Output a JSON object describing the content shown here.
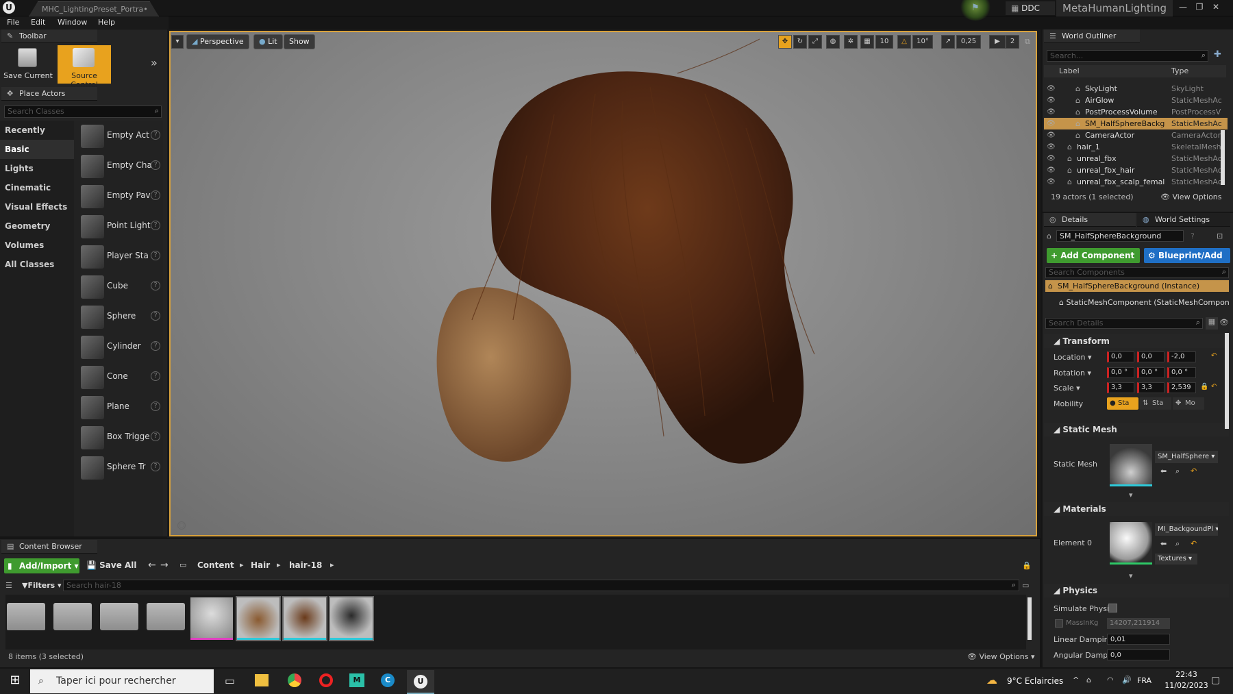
{
  "window": {
    "tab_title": "MHC_LightingPreset_Portra•",
    "ddc_label": "DDC",
    "project_name": "MetaHumanLighting"
  },
  "menu": [
    "File",
    "Edit",
    "Window",
    "Help"
  ],
  "toolbar": {
    "title": "Toolbar",
    "save_current": "Save Current",
    "source_control": "Source Control"
  },
  "place_actors": {
    "title": "Place Actors",
    "search_placeholder": "Search Classes",
    "categories": [
      "Recently Placed",
      "Basic",
      "Lights",
      "Cinematic",
      "Visual Effects",
      "Geometry",
      "Volumes",
      "All Classes"
    ],
    "selected_category": "Basic",
    "items": [
      "Empty Act",
      "Empty Cha",
      "Empty Pav",
      "Point Light",
      "Player Sta",
      "Cube",
      "Sphere",
      "Cylinder",
      "Cone",
      "Plane",
      "Box Trigge",
      "Sphere Tr"
    ]
  },
  "viewport": {
    "perspective": "Perspective",
    "lit": "Lit",
    "show": "Show",
    "grid_snap": "10",
    "rotation_snap": "10°",
    "scale_snap": "0,25",
    "camera_speed": "2"
  },
  "outliner": {
    "title": "World Outliner",
    "search_placeholder": "Search...",
    "col_label": "Label",
    "col_type": "Type",
    "rows": [
      {
        "label": "SkyLight",
        "type": "SkyLight"
      },
      {
        "label": "AirGlow",
        "type": "StaticMeshAc"
      },
      {
        "label": "PostProcessVolume",
        "type": "PostProcessV"
      },
      {
        "label": "SM_HalfSphereBackg",
        "type": "StaticMeshAc",
        "selected": true
      },
      {
        "label": "CameraActor",
        "type": "CameraActor"
      },
      {
        "label": "hair_1",
        "type": "SkeletalMesh"
      },
      {
        "label": "unreal_fbx",
        "type": "StaticMeshAc"
      },
      {
        "label": "unreal_fbx_hair",
        "type": "StaticMeshAc"
      },
      {
        "label": "unreal_fbx_scalp_femal",
        "type": "StaticMeshAc"
      }
    ],
    "status": "19 actors (1 selected)",
    "view_options": "View Options"
  },
  "details": {
    "tab_details": "Details",
    "tab_world": "World Settings",
    "object_name": "SM_HalfSphereBackground",
    "add_component": "+ Add Component",
    "blueprint": "Blueprint/Add",
    "search_components": "Search Components",
    "instance": "SM_HalfSphereBackground (Instance)",
    "component": "StaticMeshComponent (StaticMeshComponent",
    "search_details": "Search Details",
    "transform": "Transform",
    "location_label": "Location",
    "location": [
      "0,0",
      "0,0",
      "-2,0"
    ],
    "rotation_label": "Rotation",
    "rotation": [
      "0,0 °",
      "0,0 °",
      "0,0 °"
    ],
    "scale_label": "Scale",
    "scale": [
      "3,3",
      "3,3",
      "2,539"
    ],
    "mobility_label": "Mobility",
    "mobility": [
      "Sta",
      "Sta",
      "Mo"
    ],
    "static_mesh_section": "Static Mesh",
    "static_mesh_label": "Static Mesh",
    "static_mesh_value": "SM_HalfSphere",
    "materials_section": "Materials",
    "element0_label": "Element 0",
    "material_value": "MI_BackgoundPl",
    "textures": "Textures",
    "physics_section": "Physics",
    "simulate_physics": "Simulate Physic",
    "mass_label": "MassInKg",
    "mass_value": "14207,211914",
    "linear_damping_label": "Linear Damping",
    "linear_damping": "0,01",
    "angular_damping_label": "Angular Dampin",
    "angular_damping": "0,0"
  },
  "content_browser": {
    "title": "Content Browser",
    "add_import": "Add/Import",
    "save_all": "Save All",
    "path": [
      "Content",
      "Hair",
      "hair-18"
    ],
    "filters": "Filters",
    "search_placeholder": "Search hair-18",
    "status": "8 items (3 selected)",
    "view_options": "View Options"
  },
  "taskbar": {
    "search_placeholder": "Taper ici pour rechercher",
    "weather": "9°C  Eclaircies",
    "language": "FRA",
    "time": "22:43",
    "date": "11/02/2023"
  },
  "colors": {
    "accent_orange": "#d9a23c",
    "add_green": "#3f9b2f",
    "blueprint_blue": "#1f6fc5",
    "selection": "#c5944a"
  }
}
